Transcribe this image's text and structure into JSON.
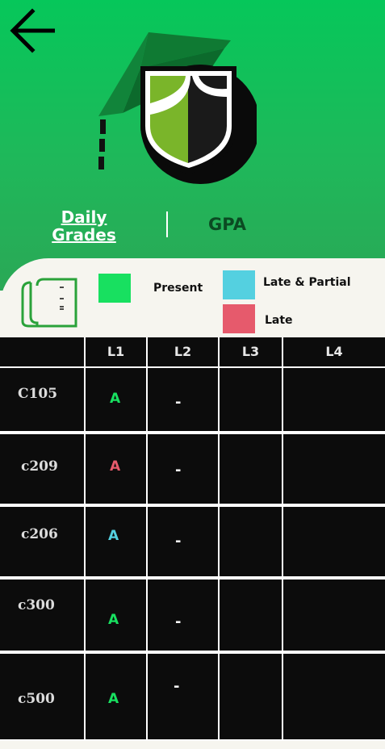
{
  "nav": {
    "back_icon": "arrow-left-icon"
  },
  "tabs": {
    "daily_line1": "Daily",
    "daily_line2": "Grades",
    "gpa": "GPA"
  },
  "legend": {
    "present": {
      "label": "Present",
      "color": "#18e060"
    },
    "late_partial": {
      "label": "Late & Partial",
      "color": "#54d0e0"
    },
    "late": {
      "label": "Late",
      "color": "#e65a6c"
    }
  },
  "table": {
    "columns": [
      "",
      "L1",
      "L2",
      "L3",
      "L4"
    ],
    "rows": [
      {
        "course": "C105",
        "l1": "A",
        "l1_color": "#18e060",
        "l2": "-",
        "l3": "",
        "l4": ""
      },
      {
        "course": "c209",
        "l1": "A",
        "l1_color": "#e65a6c",
        "l2": "-",
        "l3": "",
        "l4": ""
      },
      {
        "course": "c206",
        "l1": "A",
        "l1_color": "#54d0e0",
        "l2": "-",
        "l3": "",
        "l4": ""
      },
      {
        "course": "c300",
        "l1": "A",
        "l1_color": "#18e060",
        "l2": "-",
        "l3": "",
        "l4": ""
      },
      {
        "course": "c500",
        "l1": "A",
        "l1_color": "#18e060",
        "l2": "-",
        "l3": "",
        "l4": ""
      }
    ]
  }
}
